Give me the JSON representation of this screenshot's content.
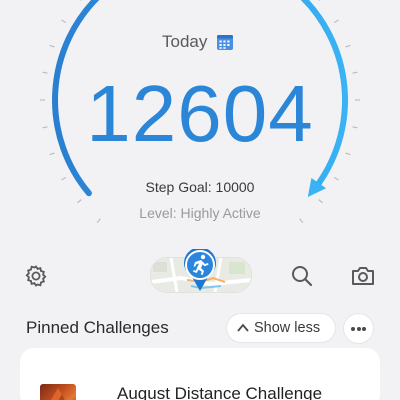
{
  "header": {
    "today_label": "Today",
    "calendar_icon": "calendar-icon"
  },
  "gauge": {
    "steps": "12604",
    "goal_text": "Step Goal: 10000",
    "level_text": "Level: Highly Active",
    "progress_fraction": 1.26,
    "colors": {
      "arc_start": "#2a7fd0",
      "arc_end": "#39b3f5",
      "ticks": "#bdbdc2"
    }
  },
  "toolbar": {
    "settings_icon": "gear-icon",
    "map_icon": "route-map-icon",
    "runner_icon": "running-person-icon",
    "search_icon": "search-icon",
    "camera_icon": "camera-icon"
  },
  "pinned": {
    "title": "Pinned Challenges",
    "show_less_label": "Show less",
    "more_icon": "more-options-icon"
  },
  "challenges": [
    {
      "title": "August Distance Challenge"
    }
  ],
  "colors": {
    "accent": "#2b86d8",
    "background": "#f2f2f4"
  }
}
